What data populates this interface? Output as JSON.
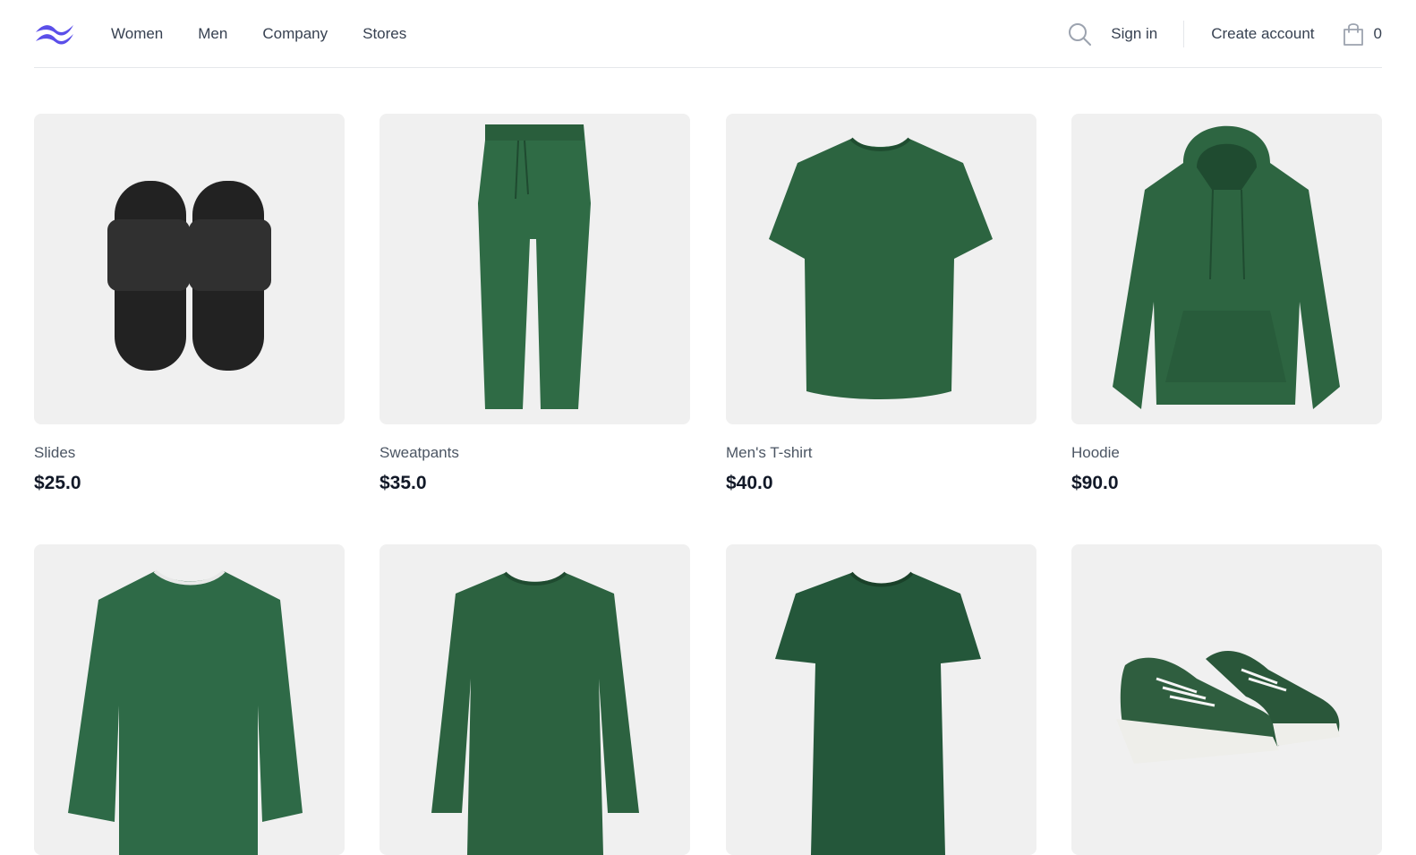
{
  "brand": {
    "logo_icon": "tailwind-wave-icon",
    "accent": "#5b4fe9"
  },
  "nav": {
    "items": [
      "Women",
      "Men",
      "Company",
      "Stores"
    ]
  },
  "header": {
    "search_icon": "search-icon",
    "sign_in": "Sign in",
    "create_account": "Create account",
    "cart_icon": "shopping-bag-icon",
    "cart_count": "0"
  },
  "products": [
    {
      "name": "Slides",
      "price": "$25.0",
      "image": "slides",
      "color": "#2b2b2b"
    },
    {
      "name": "Sweatpants",
      "price": "$35.0",
      "image": "sweatpants",
      "color": "#2f6b45"
    },
    {
      "name": "Men's T-shirt",
      "price": "$40.0",
      "image": "tshirt",
      "color": "#2c6440"
    },
    {
      "name": "Hoodie",
      "price": "$90.0",
      "image": "hoodie",
      "color": "#2d6541"
    },
    {
      "image": "sweatshirt",
      "color": "#2e6a47"
    },
    {
      "image": "sweatshirt-women",
      "color": "#2c6240"
    },
    {
      "image": "tshirt-women",
      "color": "#24573a"
    },
    {
      "image": "sneakers",
      "color": "#2f5e3f"
    }
  ]
}
